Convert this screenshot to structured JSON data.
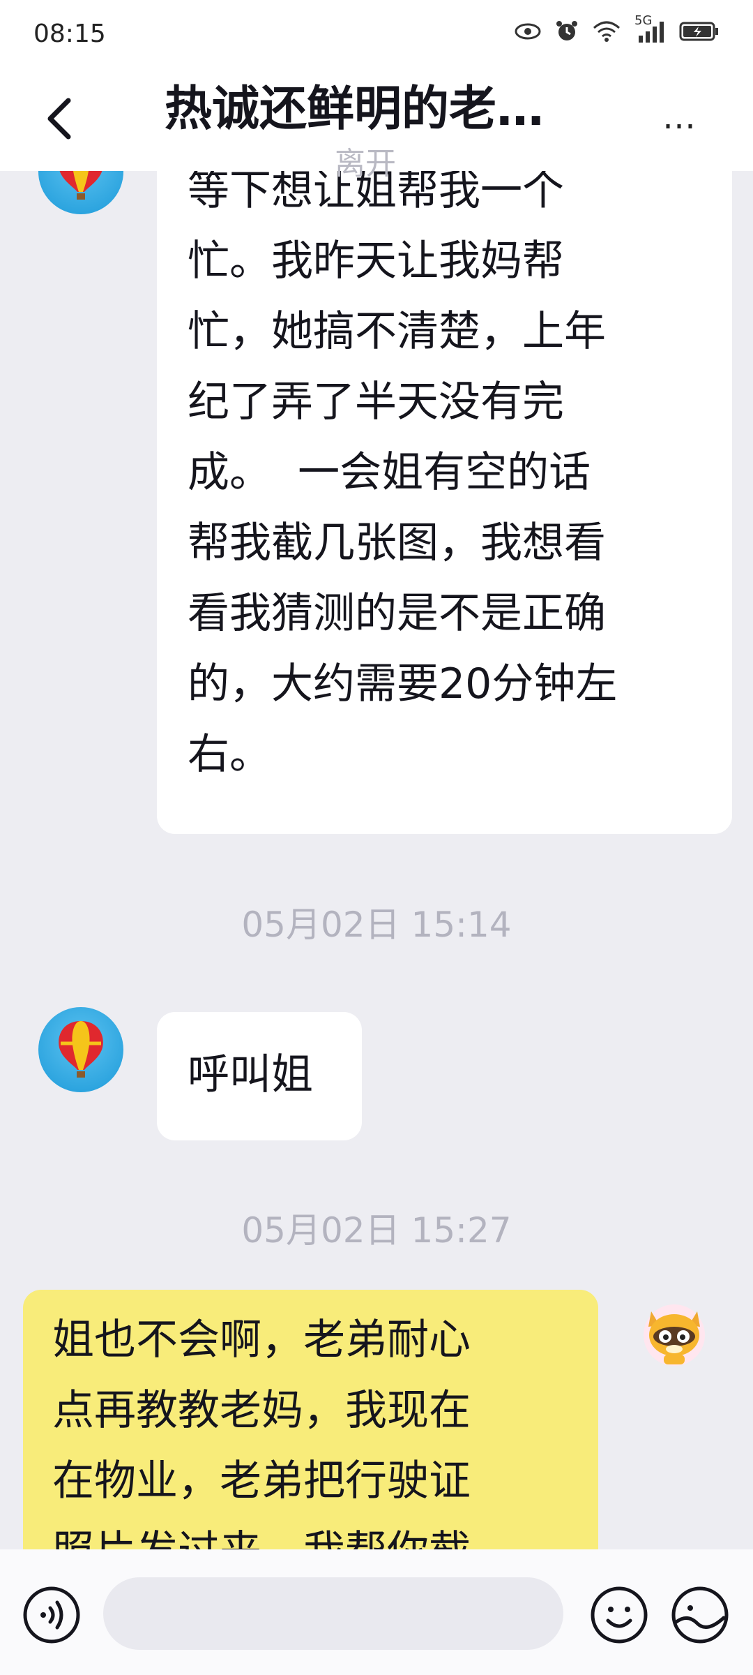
{
  "status_bar": {
    "time": "08:15",
    "network": "5G",
    "icons": [
      "eye-icon",
      "alarm-icon",
      "wifi-icon",
      "signal-icon",
      "battery-charging-icon"
    ]
  },
  "header": {
    "title": "热诚还鲜明的老…",
    "status": "离开",
    "back_icon": "chevron-left-icon",
    "more_label": "…"
  },
  "messages": [
    {
      "sender": "other",
      "text": "等下想让姐帮我一个\n忙。我昨天让我妈帮\n忙，她搞不清楚，上年\n纪了弄了半天没有完\n成。  一会姐有空的话\n帮我截几张图，我想看\n看我猜测的是不是正确\n的，大约需要20分钟左\n右。"
    },
    {
      "timestamp": "05月02日 15:14"
    },
    {
      "sender": "other",
      "text": "呼叫姐"
    },
    {
      "timestamp": "05月02日 15:27"
    },
    {
      "sender": "me",
      "text": "姐也不会啊，老弟耐心\n点再教教老妈，我现在\n在物业，老弟把行驶证\n照片发过来，我帮你截"
    }
  ],
  "input_bar": {
    "placeholder": "",
    "voice_icon": "voice-icon",
    "emoji_icon": "smiley-icon",
    "sticker_icon": "sticker-icon"
  },
  "colors": {
    "chat_background": "#ededf2",
    "other_bubble": "#ffffff",
    "my_bubble": "#f8ec7a",
    "timestamp": "#b3b3bf"
  }
}
